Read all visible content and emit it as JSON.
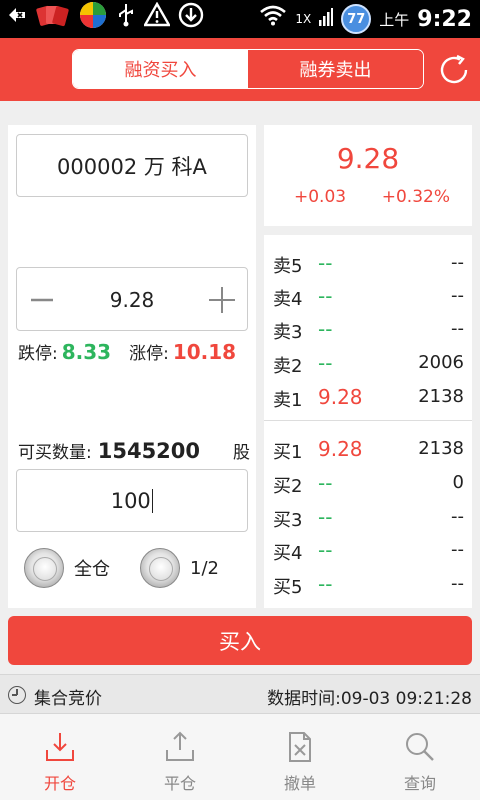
{
  "status_bar": {
    "network": "1X",
    "badge": "77",
    "ampm": "上午",
    "time": "9:22"
  },
  "header": {
    "tabs": [
      {
        "label": "融资买入",
        "active": true
      },
      {
        "label": "融券卖出",
        "active": false
      }
    ]
  },
  "form": {
    "stock": "000002 万  科A",
    "price": "9.28",
    "limit_down_label": "跌停:",
    "limit_down": "8.33",
    "limit_up_label": "涨停:",
    "limit_up": "10.18",
    "available_label": "可买数量:",
    "available_qty": "1545200",
    "available_unit": "股",
    "quantity": "100",
    "option_full": "全仓",
    "option_half": "1/2"
  },
  "quote": {
    "price": "9.28",
    "change": "+0.03",
    "change_pct": "+0.32%"
  },
  "order_book": {
    "asks": [
      {
        "label": "卖5",
        "price": "--",
        "volume": "--"
      },
      {
        "label": "卖4",
        "price": "--",
        "volume": "--"
      },
      {
        "label": "卖3",
        "price": "--",
        "volume": "--"
      },
      {
        "label": "卖2",
        "price": "--",
        "volume": "2006"
      },
      {
        "label": "卖1",
        "price": "9.28",
        "volume": "2138"
      }
    ],
    "bids": [
      {
        "label": "买1",
        "price": "9.28",
        "volume": "2138"
      },
      {
        "label": "买2",
        "price": "--",
        "volume": "0"
      },
      {
        "label": "买3",
        "price": "--",
        "volume": "--"
      },
      {
        "label": "买4",
        "price": "--",
        "volume": "--"
      },
      {
        "label": "买5",
        "price": "--",
        "volume": "--"
      }
    ]
  },
  "buy_button": "买入",
  "info_bar": {
    "auction": "集合竞价",
    "data_time": "数据时间:09-03 09:21:28"
  },
  "bottom_nav": [
    {
      "label": "开仓",
      "icon": "download-tray-icon",
      "active": true
    },
    {
      "label": "平仓",
      "icon": "upload-tray-icon",
      "active": false
    },
    {
      "label": "撤单",
      "icon": "cancel-doc-icon",
      "active": false
    },
    {
      "label": "查询",
      "icon": "search-icon",
      "active": false
    }
  ],
  "colors": {
    "accent": "#f0473d",
    "up": "#f0473d",
    "down": "#2db55d"
  }
}
